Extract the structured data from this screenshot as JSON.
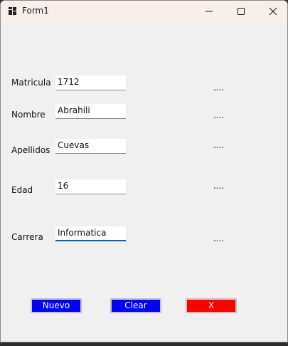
{
  "window": {
    "title": "Form1",
    "app_icon": "windows-form-icon",
    "controls": {
      "minimize_icon": "minimize-icon",
      "maximize_icon": "maximize-icon",
      "close_icon": "close-icon"
    }
  },
  "form": {
    "fields": [
      {
        "label": "Matricula",
        "value": "1712",
        "output": "...."
      },
      {
        "label": "Nombre",
        "value": "Abrahili",
        "output": "...."
      },
      {
        "label": "Apellidos",
        "value": "Cuevas",
        "output": "...."
      },
      {
        "label": "Edad",
        "value": "16",
        "output": "...."
      },
      {
        "label": "Carrera",
        "value": "Informatica",
        "output": "...."
      }
    ]
  },
  "buttons": {
    "nuevo": {
      "label": "Nuevo",
      "color": "#0000ff"
    },
    "clear": {
      "label": "Clear",
      "color": "#0000ff"
    },
    "exit": {
      "label": "X",
      "color": "#ff0000"
    }
  },
  "colors": {
    "focus_accent": "#0a64b4",
    "titlebar": "#f8efea",
    "client": "#f0f0f0"
  }
}
